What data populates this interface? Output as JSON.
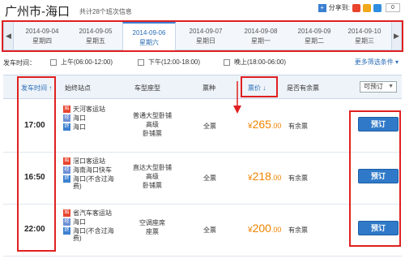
{
  "header": {
    "route": "广州市-海口",
    "count": "共计28个班次信息",
    "share_label": "分享到:",
    "share_count": "0"
  },
  "datebar": {
    "prev_arrow": "◀",
    "next_arrow": "▶",
    "tabs": [
      {
        "date": "2014-09-04",
        "weekday": "星期四"
      },
      {
        "date": "2014-09-05",
        "weekday": "星期五"
      },
      {
        "date": "2014-09-06",
        "weekday": "星期六"
      },
      {
        "date": "2014-09-07",
        "weekday": "星期日"
      },
      {
        "date": "2014-09-08",
        "weekday": "星期一"
      },
      {
        "date": "2014-09-09",
        "weekday": "星期二"
      },
      {
        "date": "2014-09-10",
        "weekday": "星期三"
      }
    ],
    "active_index": 2
  },
  "filter": {
    "label": "发车时间：",
    "options": [
      "上午(06:00-12:00)",
      "下午(12:00-18:00)",
      "晚上(18:00-06:00)"
    ],
    "more": "更多筛选条件 ▾"
  },
  "table": {
    "headers": {
      "time": "发车时间 ↑",
      "stops": "始终站点",
      "vehicle": "车型座型",
      "ticket": "票种",
      "price": "票价 ↓",
      "avail": "是否有余票",
      "dropdown": "可预订"
    },
    "rows": [
      {
        "time": "17:00",
        "stops": [
          {
            "badge": "始",
            "name": "天河客运站"
          },
          {
            "badge": "经",
            "name": "海口"
          },
          {
            "badge": "终",
            "name": "海口"
          }
        ],
        "vehicle": [
          "普通大型卧铺",
          "高级",
          "卧铺票"
        ],
        "ticket": "全票",
        "price_currency": "¥",
        "price_int": "265",
        "price_dec": ".00",
        "avail": "有余票",
        "button": "预订"
      },
      {
        "time": "16:50",
        "stops": [
          {
            "badge": "始",
            "name": "滘口客运站"
          },
          {
            "badge": "经",
            "name": "海南海口快车"
          },
          {
            "badge": "终",
            "name": "海口(不含过海费)"
          }
        ],
        "vehicle": [
          "直达大型卧铺",
          "高级",
          "卧铺票"
        ],
        "ticket": "全票",
        "price_currency": "¥",
        "price_int": "218",
        "price_dec": ".00",
        "avail": "有余票",
        "button": "预订"
      },
      {
        "time": "22:00",
        "stops": [
          {
            "badge": "始",
            "name": "省汽车客运站"
          },
          {
            "badge": "经",
            "name": "海口"
          },
          {
            "badge": "终",
            "name": "海口(不含过海费)"
          }
        ],
        "vehicle": [
          "空调座席",
          "座票"
        ],
        "ticket": "全票",
        "price_currency": "¥",
        "price_int": "200",
        "price_dec": ".00",
        "avail": "有余票",
        "button": "预订"
      }
    ]
  },
  "colors": {
    "accent": "#2f79c8",
    "price": "#f08300",
    "annotation": "#e02020"
  }
}
